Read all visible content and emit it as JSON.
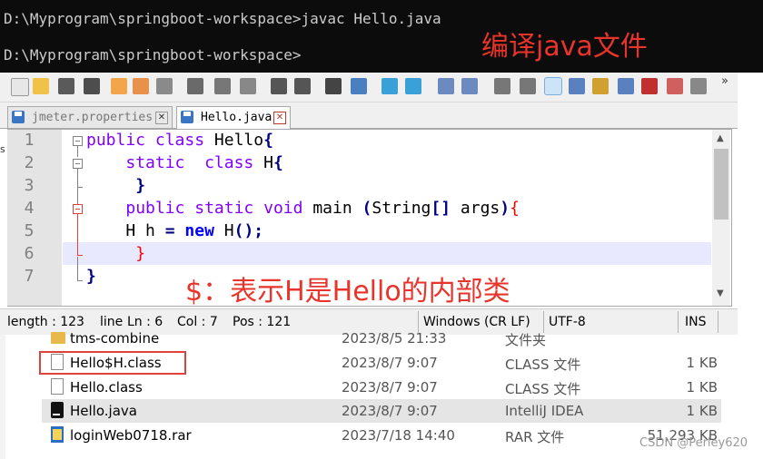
{
  "console": {
    "line1": "D:\\Myprogram\\springboot-workspace>javac Hello.java",
    "line2": "D:\\Myprogram\\springboot-workspace>",
    "annotation": "编译java文件"
  },
  "toolbar": {
    "icons": [
      "new-file-icon",
      "open-icon",
      "save-icon",
      "save-all-icon",
      "close-icon",
      "close-all-icon",
      "print-icon",
      "cut-icon",
      "copy-icon",
      "paste-icon",
      "undo-icon",
      "redo-icon",
      "find-icon",
      "replace-icon",
      "zoom-in-icon",
      "zoom-out-icon",
      "sync-v-icon",
      "sync-h-icon",
      "word-wrap-icon",
      "show-all-chars-icon",
      "indent-guide-icon",
      "udl-icon",
      "doc-map-icon",
      "function-list-icon",
      "folder-workspace-icon",
      "monitor-icon",
      "record-macro-icon",
      "more-icon"
    ],
    "more": "»"
  },
  "tabs": [
    {
      "label": "jmeter.properties",
      "close": "✕"
    },
    {
      "label": "Hello.java",
      "close": "✕"
    }
  ],
  "editor": {
    "line_numbers": [
      "1",
      "2",
      "3",
      "4",
      "5",
      "6",
      "7"
    ],
    "annotation": "$：表示H是Hello的内部类"
  },
  "status": {
    "length": "length : 123",
    "line_trunc": "line",
    "ln": "Ln : 6",
    "col": "Col : 7",
    "pos": "Pos : 121",
    "eol": "Windows (CR LF)",
    "encoding": "UTF-8",
    "mode": "INS"
  },
  "explorer": {
    "files": [
      {
        "name": "tms-combine",
        "date": "2023/8/5 21:33",
        "type": "文件夹",
        "size": "",
        "icon": "folder-icon"
      },
      {
        "name": "Hello$H.class",
        "date": "2023/8/7 9:07",
        "type": "CLASS 文件",
        "size": "1 KB",
        "icon": "class-file-icon"
      },
      {
        "name": "Hello.class",
        "date": "2023/8/7 9:07",
        "type": "CLASS 文件",
        "size": "1 KB",
        "icon": "class-file-icon"
      },
      {
        "name": "Hello.java",
        "date": "2023/8/7 9:07",
        "type": "IntelliJ IDEA",
        "size": "1 KB",
        "icon": "intellij-icon"
      },
      {
        "name": "loginWeb0718.rar",
        "date": "2023/7/18 14:40",
        "type": "RAR 文件",
        "size": "51,293 KB",
        "icon": "rar-icon"
      }
    ]
  },
  "watermark": "CSDN @Perley620",
  "colors": {
    "annotation": "#e8342a",
    "keyword": "#8000ff",
    "bold_keyword": "#0000ff",
    "brace": "#ff0000",
    "caret_line": "#e8e8ff"
  }
}
